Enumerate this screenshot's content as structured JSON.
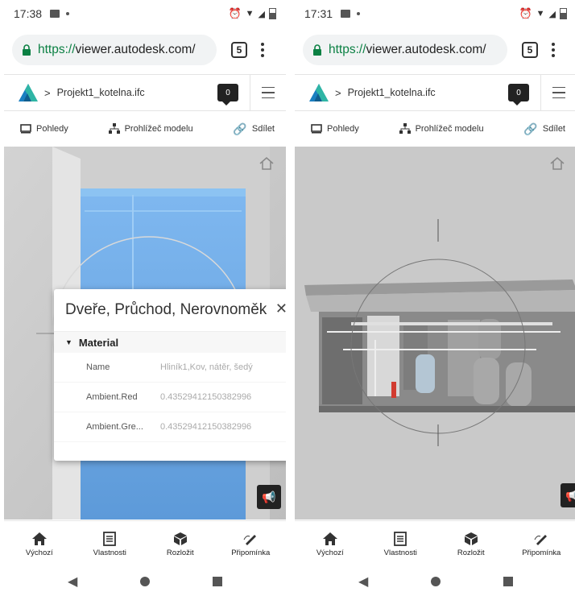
{
  "left": {
    "status_time": "17:38",
    "url_scheme": "https://",
    "url_host": "viewer.autodesk.com/",
    "tabs_count": "5",
    "breadcrumb": "Projekt1_kotelna.ifc",
    "comment_count": "0",
    "toolbar": {
      "views": "Pohledy",
      "model_browser": "Prohlížeč modelu",
      "share": "Sdílet"
    },
    "panel": {
      "title": "Dveře, Průchod, Nerovnoměk",
      "section": "Material",
      "rows": [
        {
          "key": "Name",
          "value": "Hliník1,Kov, nátěr, šedý"
        },
        {
          "key": "Ambient.Red",
          "value": "0.43529412150382996"
        },
        {
          "key": "Ambient.Gre...",
          "value": "0.43529412150382996"
        }
      ]
    },
    "bottom_nav": {
      "home": "Výchozí",
      "properties": "Vlastnosti",
      "explode": "Rozložit",
      "comment": "Připomínka"
    }
  },
  "right": {
    "status_time": "17:31",
    "url_scheme": "https://",
    "url_host": "viewer.autodesk.com/",
    "tabs_count": "5",
    "breadcrumb": "Projekt1_kotelna.ifc",
    "comment_count": "0",
    "toolbar": {
      "views": "Pohledy",
      "model_browser": "Prohlížeč modelu",
      "share": "Sdílet"
    },
    "bottom_nav": {
      "home": "Výchozí",
      "properties": "Vlastnosti",
      "explode": "Rozložit",
      "comment": "Připomínka"
    }
  },
  "colors": {
    "lock_green": "#0b8043",
    "glass_blue": "#6fa9e6",
    "viewport_grey": "#c9c9c9"
  }
}
